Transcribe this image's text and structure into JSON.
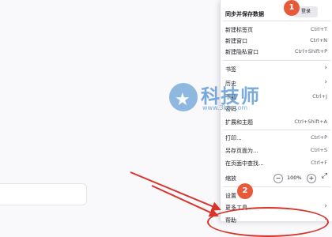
{
  "menu": {
    "sync_title": "同步并保存数据",
    "login_label": "登录",
    "items": {
      "new_tab": {
        "label": "新建标签页",
        "shortcut": "Ctrl+T"
      },
      "new_window": {
        "label": "新建窗口",
        "shortcut": "Ctrl+N"
      },
      "new_private": {
        "label": "新建隐私窗口",
        "shortcut": "Ctrl+Shift+P"
      },
      "bookmarks": {
        "label": "书签"
      },
      "history": {
        "label": "历史"
      },
      "downloads": {
        "label": "下载",
        "shortcut": "Ctrl+J"
      },
      "passwords": {
        "label": "密码"
      },
      "extensions": {
        "label": "扩展和主题",
        "shortcut": "Ctrl+Shift+A"
      },
      "print": {
        "label": "打印...",
        "shortcut": "Ctrl+P"
      },
      "save_as": {
        "label": "另存页面为...",
        "shortcut": "Ctrl+S"
      },
      "find": {
        "label": "在页面中查找...",
        "shortcut": "Ctrl+F"
      },
      "zoom": {
        "label": "缩放",
        "value": "100%",
        "minus": "−",
        "plus": "+"
      },
      "settings": {
        "label": "设置"
      },
      "more_tools": {
        "label": "更多工具"
      },
      "help": {
        "label": "帮助"
      }
    }
  },
  "annotations": {
    "step1": "1",
    "step2": "2",
    "accent_color": "#e8593a",
    "arrow_color": "#d9342b"
  },
  "watermark": {
    "text": "科技师",
    "url": "www.3kjs.com"
  },
  "icons": {
    "arrow_right": "›",
    "fullscreen": "⤢",
    "star": "★"
  }
}
